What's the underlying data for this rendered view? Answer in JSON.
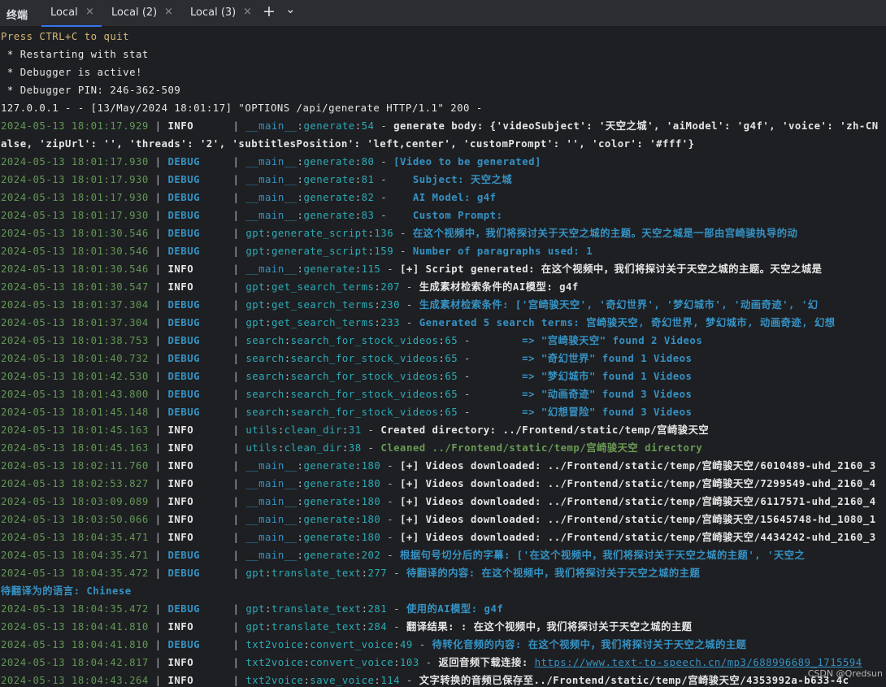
{
  "tabbar": {
    "title": "终端",
    "tabs": [
      {
        "label": "Local",
        "close": "×",
        "active": true
      },
      {
        "label": "Local (2)",
        "close": "×",
        "active": false
      },
      {
        "label": "Local (3)",
        "close": "×",
        "active": false
      }
    ],
    "add_glyph": "+",
    "menu_glyph": "⌄"
  },
  "console": {
    "preface": [
      {
        "text": "Press CTRL+C to quit",
        "style": "warn"
      },
      {
        "text": " * Restarting with stat",
        "style": "plain-b"
      },
      {
        "text": " * Debugger is active!",
        "style": "plain-b"
      },
      {
        "text": " * Debugger PIN: 246-362-509",
        "style": "plain-b"
      },
      {
        "text": "127.0.0.1 - - [13/May/2024 18:01:17] \"OPTIONS /api/generate HTTP/1.1\" 200 -",
        "style": "plain-b"
      }
    ],
    "logs": [
      {
        "ts": "2024-05-13 18:01:17.929",
        "level": "INFO",
        "mod": "__main__",
        "fn": "generate",
        "no": "54",
        "msg": "generate body: {'videoSubject': '天空之城', 'aiModel': 'g4f', 'voice': 'zh-CN",
        "style": "i"
      },
      {
        "cont": "alse, 'zipUrl': '', 'threads': '2', 'subtitlesPosition': 'left,center', 'customPrompt': '', 'color': '#fff'}",
        "style": "i"
      },
      {
        "ts": "2024-05-13 18:01:17.930",
        "level": "DEBUG",
        "mod": "__main__",
        "fn": "generate",
        "no": "80",
        "msg": "[Video to be generated]",
        "style": "d"
      },
      {
        "ts": "2024-05-13 18:01:17.930",
        "level": "DEBUG",
        "mod": "__main__",
        "fn": "generate",
        "no": "81",
        "msg": "   Subject: 天空之城",
        "style": "d"
      },
      {
        "ts": "2024-05-13 18:01:17.930",
        "level": "DEBUG",
        "mod": "__main__",
        "fn": "generate",
        "no": "82",
        "msg": "   AI Model: g4f",
        "style": "d"
      },
      {
        "ts": "2024-05-13 18:01:17.930",
        "level": "DEBUG",
        "mod": "__main__",
        "fn": "generate",
        "no": "83",
        "msg": "   Custom Prompt:",
        "style": "d"
      },
      {
        "ts": "2024-05-13 18:01:30.546",
        "level": "DEBUG",
        "mod": "gpt",
        "fn": "generate_script",
        "no": "136",
        "msg": "在这个视频中，我们将探讨关于天空之城的主题。天空之城是一部由宫崎骏执导的动",
        "style": "d"
      },
      {
        "ts": "2024-05-13 18:01:30.546",
        "level": "DEBUG",
        "mod": "gpt",
        "fn": "generate_script",
        "no": "159",
        "msg": "Number of paragraphs used: 1",
        "style": "d"
      },
      {
        "ts": "2024-05-13 18:01:30.546",
        "level": "INFO",
        "mod": "__main__",
        "fn": "generate",
        "no": "115",
        "msg": "[+] Script generated: 在这个视频中，我们将探讨关于天空之城的主题。天空之城是",
        "style": "i"
      },
      {
        "ts": "2024-05-13 18:01:30.547",
        "level": "INFO",
        "mod": "gpt",
        "fn": "get_search_terms",
        "no": "207",
        "msg": "生成素材检索条件的AI模型: g4f",
        "style": "i"
      },
      {
        "ts": "2024-05-13 18:01:37.304",
        "level": "DEBUG",
        "mod": "gpt",
        "fn": "get_search_terms",
        "no": "230",
        "msg": "生成素材检索条件: ['宫崎骏天空', '奇幻世界', '梦幻城市', '动画奇迹', '幻",
        "style": "d"
      },
      {
        "ts": "2024-05-13 18:01:37.304",
        "level": "DEBUG",
        "mod": "gpt",
        "fn": "get_search_terms",
        "no": "233",
        "msg": "Generated 5 search terms: 宫崎骏天空, 奇幻世界, 梦幻城市, 动画奇迹, 幻想",
        "style": "d"
      },
      {
        "ts": "2024-05-13 18:01:38.753",
        "level": "DEBUG",
        "mod": "search",
        "fn": "search_for_stock_videos",
        "no": "65",
        "msg": "       => \"宫崎骏天空\" found 2 Videos",
        "style": "d"
      },
      {
        "ts": "2024-05-13 18:01:40.732",
        "level": "DEBUG",
        "mod": "search",
        "fn": "search_for_stock_videos",
        "no": "65",
        "msg": "       => \"奇幻世界\" found 1 Videos",
        "style": "d"
      },
      {
        "ts": "2024-05-13 18:01:42.530",
        "level": "DEBUG",
        "mod": "search",
        "fn": "search_for_stock_videos",
        "no": "65",
        "msg": "       => \"梦幻城市\" found 1 Videos",
        "style": "d"
      },
      {
        "ts": "2024-05-13 18:01:43.800",
        "level": "DEBUG",
        "mod": "search",
        "fn": "search_for_stock_videos",
        "no": "65",
        "msg": "       => \"动画奇迹\" found 3 Videos",
        "style": "d"
      },
      {
        "ts": "2024-05-13 18:01:45.148",
        "level": "DEBUG",
        "mod": "search",
        "fn": "search_for_stock_videos",
        "no": "65",
        "msg": "       => \"幻想冒险\" found 3 Videos",
        "style": "d"
      },
      {
        "ts": "2024-05-13 18:01:45.163",
        "level": "INFO",
        "mod": "utils",
        "fn": "clean_dir",
        "no": "31",
        "msg": "Created directory: ../Frontend/static/temp/宫崎骏天空",
        "style": "i"
      },
      {
        "ts": "2024-05-13 18:01:45.163",
        "level": "INFO",
        "mod": "utils",
        "fn": "clean_dir",
        "no": "38",
        "msg": "Cleaned ../Frontend/static/temp/宫崎骏天空 directory",
        "style": "g"
      },
      {
        "ts": "2024-05-13 18:02:11.760",
        "level": "INFO",
        "mod": "__main__",
        "fn": "generate",
        "no": "180",
        "msg": "[+] Videos downloaded: ../Frontend/static/temp/宫崎骏天空/6010489-uhd_2160_3",
        "style": "i"
      },
      {
        "ts": "2024-05-13 18:02:53.827",
        "level": "INFO",
        "mod": "__main__",
        "fn": "generate",
        "no": "180",
        "msg": "[+] Videos downloaded: ../Frontend/static/temp/宫崎骏天空/7299549-uhd_2160_4",
        "style": "i"
      },
      {
        "ts": "2024-05-13 18:03:09.089",
        "level": "INFO",
        "mod": "__main__",
        "fn": "generate",
        "no": "180",
        "msg": "[+] Videos downloaded: ../Frontend/static/temp/宫崎骏天空/6117571-uhd_2160_4",
        "style": "i"
      },
      {
        "ts": "2024-05-13 18:03:50.066",
        "level": "INFO",
        "mod": "__main__",
        "fn": "generate",
        "no": "180",
        "msg": "[+] Videos downloaded: ../Frontend/static/temp/宫崎骏天空/15645748-hd_1080_1",
        "style": "i"
      },
      {
        "ts": "2024-05-13 18:04:35.471",
        "level": "INFO",
        "mod": "__main__",
        "fn": "generate",
        "no": "180",
        "msg": "[+] Videos downloaded: ../Frontend/static/temp/宫崎骏天空/4434242-uhd_2160_3",
        "style": "i"
      },
      {
        "ts": "2024-05-13 18:04:35.471",
        "level": "DEBUG",
        "mod": "__main__",
        "fn": "generate",
        "no": "202",
        "msg": "根据句号切分后的字幕: ['在这个视频中，我们将探讨关于天空之城的主题', '天空之",
        "style": "d"
      },
      {
        "ts": "2024-05-13 18:04:35.472",
        "level": "DEBUG",
        "mod": "gpt",
        "fn": "translate_text",
        "no": "277",
        "msg": "待翻译的内容: 在这个视频中，我们将探讨关于天空之城的主题",
        "style": "d"
      },
      {
        "cont": "待翻译为的语言: Chinese",
        "style": "d"
      },
      {
        "ts": "2024-05-13 18:04:35.472",
        "level": "DEBUG",
        "mod": "gpt",
        "fn": "translate_text",
        "no": "281",
        "msg": "使用的AI模型: g4f",
        "style": "d"
      },
      {
        "ts": "2024-05-13 18:04:41.810",
        "level": "INFO",
        "mod": "gpt",
        "fn": "translate_text",
        "no": "284",
        "msg": "翻译结果: : 在这个视频中，我们将探讨关于天空之城的主题",
        "style": "i"
      },
      {
        "ts": "2024-05-13 18:04:41.810",
        "level": "DEBUG",
        "mod": "txt2voice",
        "fn": "convert_voice",
        "no": "49",
        "msg": "待转化音频的内容: 在这个视频中，我们将探讨关于天空之城的主题",
        "style": "d"
      },
      {
        "ts": "2024-05-13 18:04:42.817",
        "level": "INFO",
        "mod": "txt2voice",
        "fn": "convert_voice",
        "no": "103",
        "msg": "返回音频下载连接: ",
        "link": "https://www.text-to-speech.cn/mp3/688996689_1715594",
        "style": "i"
      },
      {
        "ts": "2024-05-13 18:04:43.264",
        "level": "INFO",
        "mod": "txt2voice",
        "fn": "save_voice",
        "no": "114",
        "msg": "文字转换的音频已保存至../Frontend/static/temp/宫崎骏天空/4353992a-b633-4c",
        "style": "i"
      }
    ]
  },
  "watermark": "CSDN @Qredsun"
}
